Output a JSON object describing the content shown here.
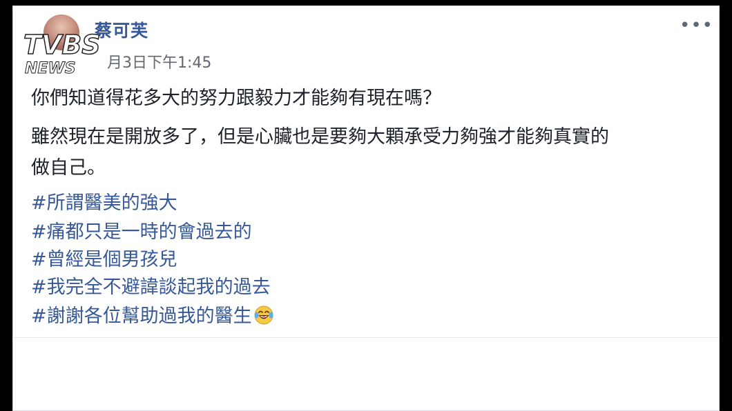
{
  "post": {
    "author": "蔡可芙",
    "timestamp": "月3日下午1:45",
    "more_label": "•••",
    "paragraphs": [
      "你們知道得花多大的努力跟毅力才能夠有現在嗎？",
      "雖然現在是開放多了，但是心臟也是要夠大顆承受力夠強才能夠真實的",
      "做自己。"
    ],
    "hashtags": [
      "#所謂醫美的強大",
      "#痛都只是一時的會過去的",
      "#曾經是個男孩兒",
      "#我完全不避諱談起我的過去",
      "#謝謝各位幫助過我的醫生"
    ],
    "emoji": "laughing-tears-emoji"
  },
  "watermark": {
    "brand": "TVBS",
    "sub": "NEWS"
  },
  "colors": {
    "link": "#365899",
    "text": "#1d2129",
    "meta": "#616770",
    "frame": "#000000"
  }
}
